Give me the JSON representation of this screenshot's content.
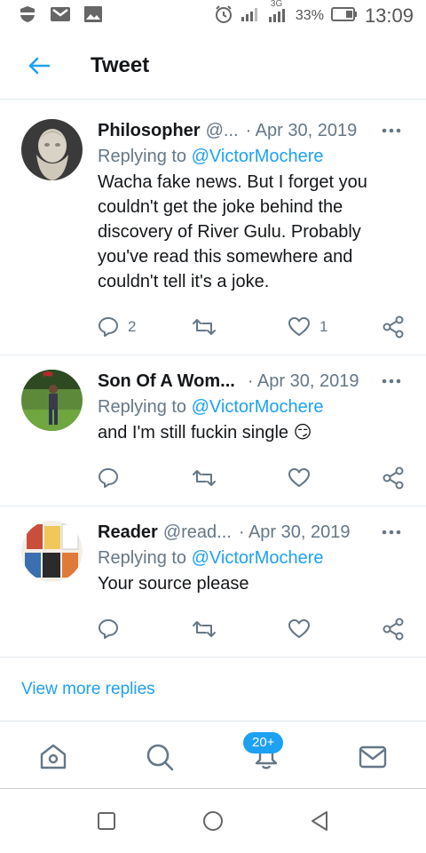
{
  "status_bar": {
    "battery_percent": "33%",
    "network": "3G",
    "time": "13:09",
    "icons": [
      "shield-icon",
      "gmail-icon",
      "gallery-icon",
      "alarm-icon",
      "signal-icon",
      "signal-3g-icon",
      "battery-icon"
    ]
  },
  "header": {
    "title": "Tweet",
    "back_icon": "back-arrow-icon"
  },
  "tweets": [
    {
      "name": "Philosopher",
      "handle": "@...",
      "date": "· Apr 30, 2019",
      "reply_prefix": "Replying to",
      "reply_to": "@VictorMochere",
      "text": "Wacha fake news. But I forget you couldn't get the joke behind the discovery of River Gulu. Probably you've read this somewhere and couldn't tell it's a joke.",
      "reply_count": "2",
      "retweet_count": "",
      "like_count": "1"
    },
    {
      "name": "Son Of A Wom...",
      "handle": "",
      "date": "· Apr 30, 2019",
      "reply_prefix": "Replying to",
      "reply_to": "@VictorMochere",
      "text": "and I'm still fuckin single 😏",
      "reply_count": "",
      "retweet_count": "",
      "like_count": ""
    },
    {
      "name": "Reader",
      "handle": "@read...",
      "date": "· Apr 30, 2019",
      "reply_prefix": "Replying to",
      "reply_to": "@VictorMochere",
      "text": "Your source please",
      "reply_count": "",
      "retweet_count": "",
      "like_count": ""
    }
  ],
  "view_more": "View more replies",
  "tabbar": {
    "notification_badge": "20+",
    "tabs": [
      "home-icon",
      "search-icon",
      "notifications-icon",
      "messages-icon"
    ]
  },
  "colors": {
    "accent": "#1da1f2",
    "secondary_text": "#657786",
    "primary_text": "#14171a",
    "divider": "#e6ecf0"
  }
}
